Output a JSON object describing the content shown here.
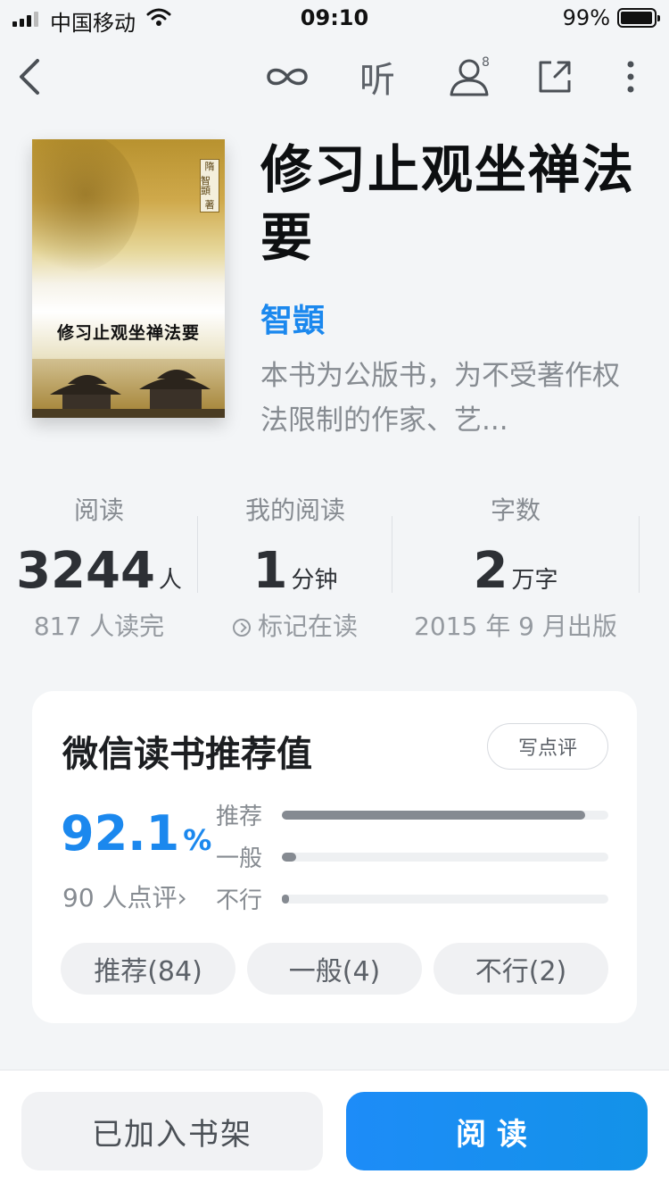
{
  "status_bar": {
    "carrier": "中国移动",
    "time": "09:10",
    "battery": "99%"
  },
  "nav": {
    "listen_label": "听",
    "friends_count": "8",
    "icons": [
      "back-icon",
      "infinity-icon",
      "person-icon",
      "share-icon",
      "more-icon"
    ]
  },
  "book": {
    "cover_title": "修习止观坐禅法要",
    "cover_seal": [
      "隋",
      "智顗",
      "著"
    ],
    "title": "修习止观坐禅法要",
    "author": "智顗",
    "description": "本书为公版书，为不受著作权法限制的作家、艺..."
  },
  "stats": {
    "readers": {
      "label": "阅读",
      "value": "3244",
      "unit": "人",
      "sub": "817 人读完"
    },
    "my_reading": {
      "label": "我的阅读",
      "value": "1",
      "unit": "分钟",
      "sub": "标记在读"
    },
    "word_count": {
      "label": "字数",
      "value": "2",
      "unit": "万字",
      "sub": "2015 年 9 月出版"
    }
  },
  "recommend": {
    "title": "微信读书推荐值",
    "review_button": "写点评",
    "percent": "92.1",
    "percent_sign": "%",
    "rating_count": "90 人点评›",
    "bars": [
      {
        "label": "推荐",
        "fraction": 0.93
      },
      {
        "label": "一般",
        "fraction": 0.044
      },
      {
        "label": "不行",
        "fraction": 0.022
      }
    ],
    "chips": [
      "推荐(84)",
      "一般(4)",
      "不行(2)"
    ]
  },
  "bottom": {
    "shelf_button": "已加入书架",
    "read_button": "阅读"
  },
  "colors": {
    "accent": "#1b88ee",
    "background": "#f3f5f7",
    "bar_fill": "#858a91"
  }
}
